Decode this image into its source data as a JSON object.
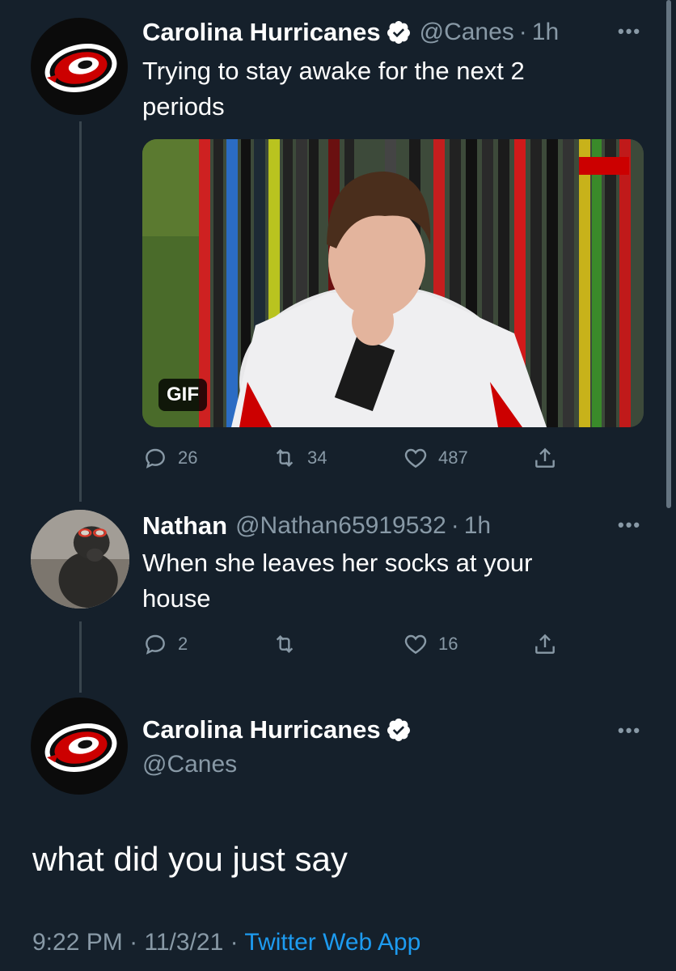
{
  "tweet1": {
    "name": "Carolina Hurricanes",
    "handle": "@Canes",
    "time": "1h",
    "text": "Trying to stay awake for the next 2 periods",
    "media_badge": "GIF",
    "replies": "26",
    "retweets": "34",
    "likes": "487"
  },
  "tweet2": {
    "name": "Nathan",
    "handle": "@Nathan65919532",
    "time": "1h",
    "text": "When she leaves her socks at your house",
    "replies": "2",
    "retweets": "",
    "likes": "16"
  },
  "main_tweet": {
    "name": "Carolina Hurricanes",
    "handle": "@Canes",
    "text": "what did you just say",
    "time": "9:22 PM",
    "date": "11/3/21",
    "source": "Twitter Web App"
  },
  "colors": {
    "background": "#15202b",
    "secondary_text": "#8899a6",
    "link": "#1d9bf0",
    "canes_red": "#cc0000"
  }
}
